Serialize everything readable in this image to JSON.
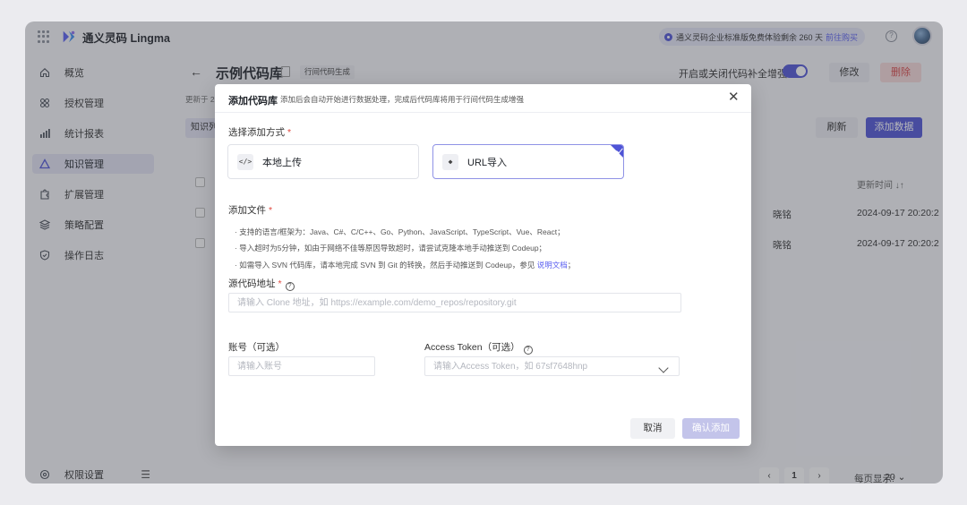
{
  "topbar": {
    "brand": "通义灵码 Lingma",
    "notice_text": "通义灵码企业标准版免费体验剩余 260 天",
    "notice_link": "前往购买"
  },
  "sidebar": {
    "items": [
      {
        "label": "概览",
        "icon": "home-icon"
      },
      {
        "label": "授权管理",
        "icon": "key-icon"
      },
      {
        "label": "统计报表",
        "icon": "bar-chart-icon"
      },
      {
        "label": "知识管理",
        "icon": "triangle-icon",
        "active": true
      },
      {
        "label": "扩展管理",
        "icon": "puzzle-icon"
      },
      {
        "label": "策略配置",
        "icon": "layers-icon"
      },
      {
        "label": "操作日志",
        "icon": "shield-check-icon"
      }
    ],
    "bottom_label": "权限设置"
  },
  "main": {
    "title": "示例代码库",
    "tag": "行间代码生成",
    "toggle_label": "开启或关闭代码补全增强",
    "toggle_on": true,
    "edit_label": "修改",
    "delete_label": "删除",
    "updated_prefix": "更新于 2",
    "tab_label": "知识列",
    "refresh_label": "刷新",
    "add_data_label": "添加数据",
    "update_time_header": "更新时间",
    "rows": [
      {
        "owner": "晓铭",
        "time": "2024-09-17 20:20:2"
      },
      {
        "owner": "晓铭",
        "time": "2024-09-17 20:20:2"
      }
    ],
    "pagination": {
      "current": "1",
      "page_size_label": "每页显示:",
      "page_size": "20"
    }
  },
  "dialog": {
    "title": "添加代码库",
    "subtitle": "添加后会自动开始进行数据处理，完成后代码库将用于行间代码生成增强",
    "method_label": "选择添加方式",
    "methods": [
      {
        "label": "本地上传",
        "icon": "code-icon",
        "selected": false
      },
      {
        "label": "URL导入",
        "icon": "git-icon",
        "selected": true
      }
    ],
    "file_label": "添加文件",
    "hints": [
      "· 支持的语言/框架为：Java、C#、C/C++、Go、Python、JavaScript、TypeScript、Vue、React；",
      "· 导入超时为5分钟，如由于网络不佳等原因导致超时，请尝试克隆本地手动推送到 Codeup；",
      "· 如需导入 SVN 代码库，请本地完成 SVN 到 Git 的转换，然后手动推送到 Codeup，参见 "
    ],
    "hint_link": "说明文档",
    "hint_tail": "；",
    "source_label": "源代码地址",
    "source_placeholder": "请输入 Clone 地址，如 https://example.com/demo_repos/repository.git",
    "account_label": "账号（可选）",
    "account_placeholder": "请输入账号",
    "token_label": "Access Token（可选）",
    "token_placeholder": "请输入Access Token，如 67sf7648hnp",
    "cancel_label": "取消",
    "confirm_label": "确认添加"
  },
  "colors": {
    "accent": "#4f54d6",
    "danger": "#d94a4a",
    "required": "#e0483e"
  }
}
